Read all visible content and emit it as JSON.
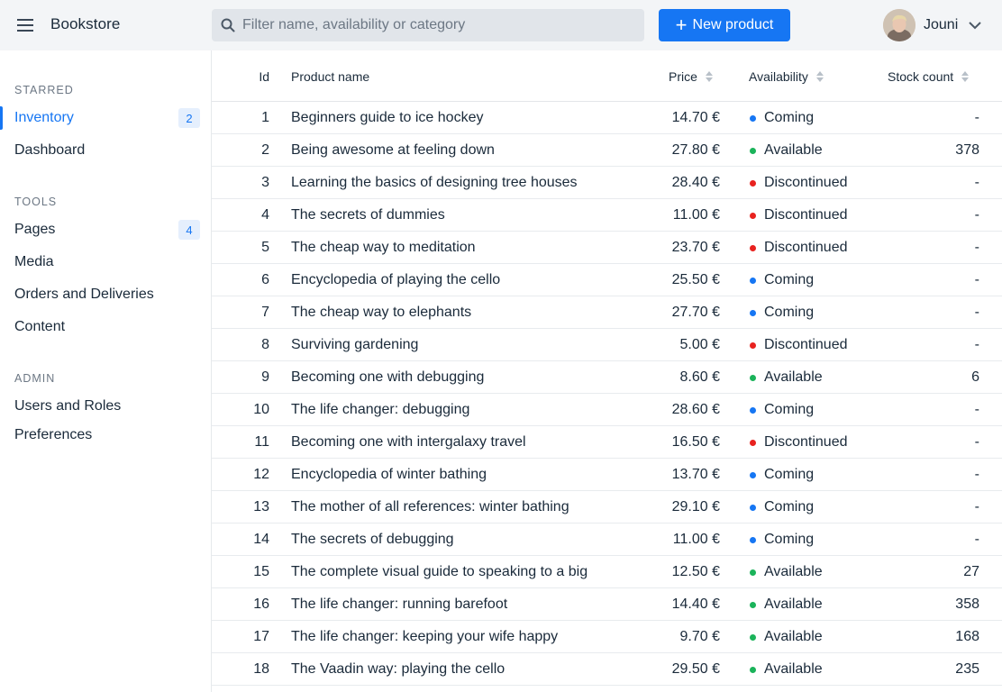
{
  "header": {
    "app_title": "Bookstore",
    "search_placeholder": "Filter name, availability or category",
    "new_button_label": "New product",
    "user_name": "Jouni"
  },
  "sidebar": {
    "sections": [
      {
        "title": "Starred",
        "items": [
          {
            "label": "Inventory",
            "badge": "2",
            "active": true
          },
          {
            "label": "Dashboard"
          }
        ]
      },
      {
        "title": "Tools",
        "items": [
          {
            "label": "Pages",
            "badge": "4"
          },
          {
            "label": "Media"
          },
          {
            "label": "Orders and Deliveries"
          },
          {
            "label": "Content"
          }
        ]
      },
      {
        "title": "Admin",
        "items": [
          {
            "label": "Users and Roles"
          },
          {
            "label": "Preferences"
          }
        ]
      }
    ]
  },
  "grid": {
    "columns": {
      "id": "Id",
      "name": "Product name",
      "price": "Price",
      "availability": "Availability",
      "stock": "Stock count"
    },
    "status_colors": {
      "Coming": "#1676f3",
      "Available": "#1bb35a",
      "Discontinued": "#e8221f"
    },
    "rows": [
      {
        "id": "1",
        "name": "Beginners guide to ice hockey",
        "price": "14.70 €",
        "availability": "Coming",
        "stock": "-"
      },
      {
        "id": "2",
        "name": "Being awesome at feeling down",
        "price": "27.80 €",
        "availability": "Available",
        "stock": "378"
      },
      {
        "id": "3",
        "name": "Learning the basics of designing tree houses",
        "price": "28.40 €",
        "availability": "Discontinued",
        "stock": "-"
      },
      {
        "id": "4",
        "name": "The secrets of dummies",
        "price": "11.00 €",
        "availability": "Discontinued",
        "stock": "-"
      },
      {
        "id": "5",
        "name": "The cheap way to meditation",
        "price": "23.70 €",
        "availability": "Discontinued",
        "stock": "-"
      },
      {
        "id": "6",
        "name": "Encyclopedia of playing the cello",
        "price": "25.50 €",
        "availability": "Coming",
        "stock": "-"
      },
      {
        "id": "7",
        "name": "The cheap way to elephants",
        "price": "27.70 €",
        "availability": "Coming",
        "stock": "-"
      },
      {
        "id": "8",
        "name": "Surviving gardening",
        "price": "5.00 €",
        "availability": "Discontinued",
        "stock": "-"
      },
      {
        "id": "9",
        "name": "Becoming one with debugging",
        "price": "8.60 €",
        "availability": "Available",
        "stock": "6"
      },
      {
        "id": "10",
        "name": "The life changer: debugging",
        "price": "28.60 €",
        "availability": "Coming",
        "stock": "-"
      },
      {
        "id": "11",
        "name": "Becoming one with intergalaxy travel",
        "price": "16.50 €",
        "availability": "Discontinued",
        "stock": "-"
      },
      {
        "id": "12",
        "name": "Encyclopedia of winter bathing",
        "price": "13.70 €",
        "availability": "Coming",
        "stock": "-"
      },
      {
        "id": "13",
        "name": "The mother of all references: winter bathing",
        "price": "29.10 €",
        "availability": "Coming",
        "stock": "-"
      },
      {
        "id": "14",
        "name": "The secrets of debugging",
        "price": "11.00 €",
        "availability": "Coming",
        "stock": "-"
      },
      {
        "id": "15",
        "name": "The complete visual guide to speaking to a big",
        "price": "12.50 €",
        "availability": "Available",
        "stock": "27"
      },
      {
        "id": "16",
        "name": "The life changer: running barefoot",
        "price": "14.40 €",
        "availability": "Available",
        "stock": "358"
      },
      {
        "id": "17",
        "name": "The life changer: keeping your wife happy",
        "price": "9.70 €",
        "availability": "Available",
        "stock": "168"
      },
      {
        "id": "18",
        "name": "The Vaadin way: playing the cello",
        "price": "29.50 €",
        "availability": "Available",
        "stock": "235"
      }
    ]
  }
}
